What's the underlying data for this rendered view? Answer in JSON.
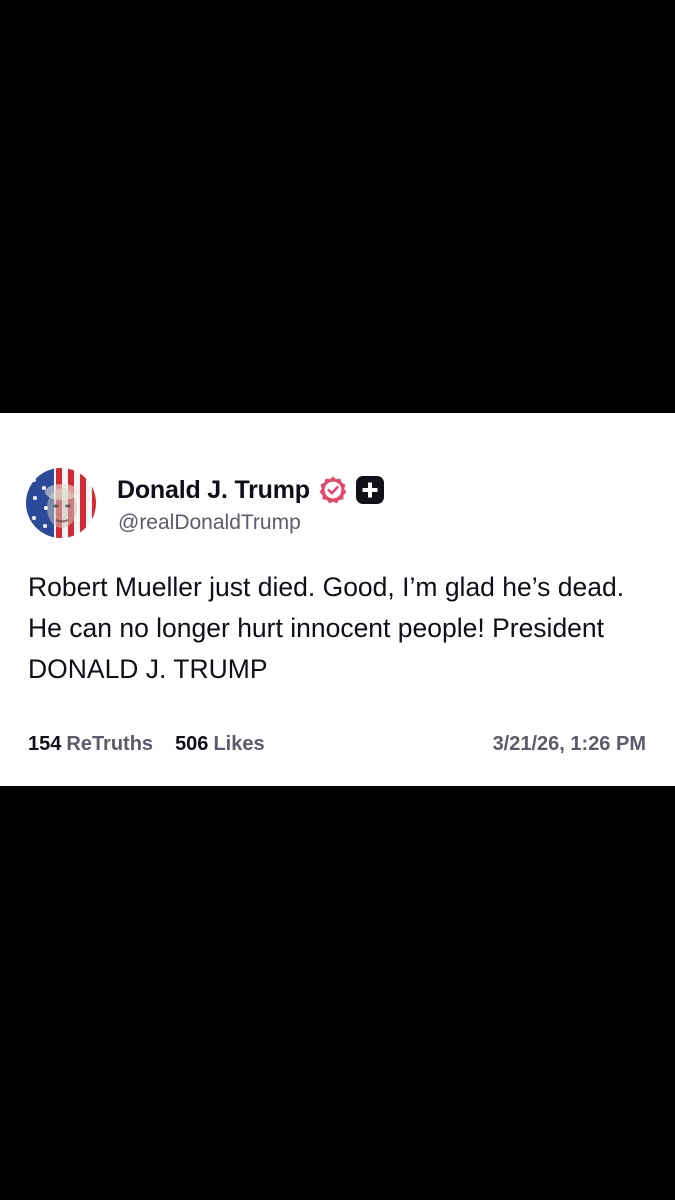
{
  "post": {
    "author": {
      "display_name": "Donald J. Trump",
      "handle": "@realDonaldTrump",
      "avatar_icon": "flag-portrait-avatar",
      "verified_icon": "verified-badge-icon",
      "verified_color": "#e8476a",
      "plus_icon": "plus-badge-icon"
    },
    "text": "Robert Mueller just died. Good, I’m glad he’s dead. He can no longer hurt innocent people! President DONALD J. TRUMP",
    "stats": {
      "retruths_count": "154",
      "retruths_label": "ReTruths",
      "likes_count": "506",
      "likes_label": "Likes"
    },
    "timestamp": "3/21/26, 1:26 PM"
  },
  "colors": {
    "background": "#000000",
    "card": "#ffffff",
    "text_primary": "#0f0f1a",
    "text_secondary": "#5b5b6b"
  }
}
